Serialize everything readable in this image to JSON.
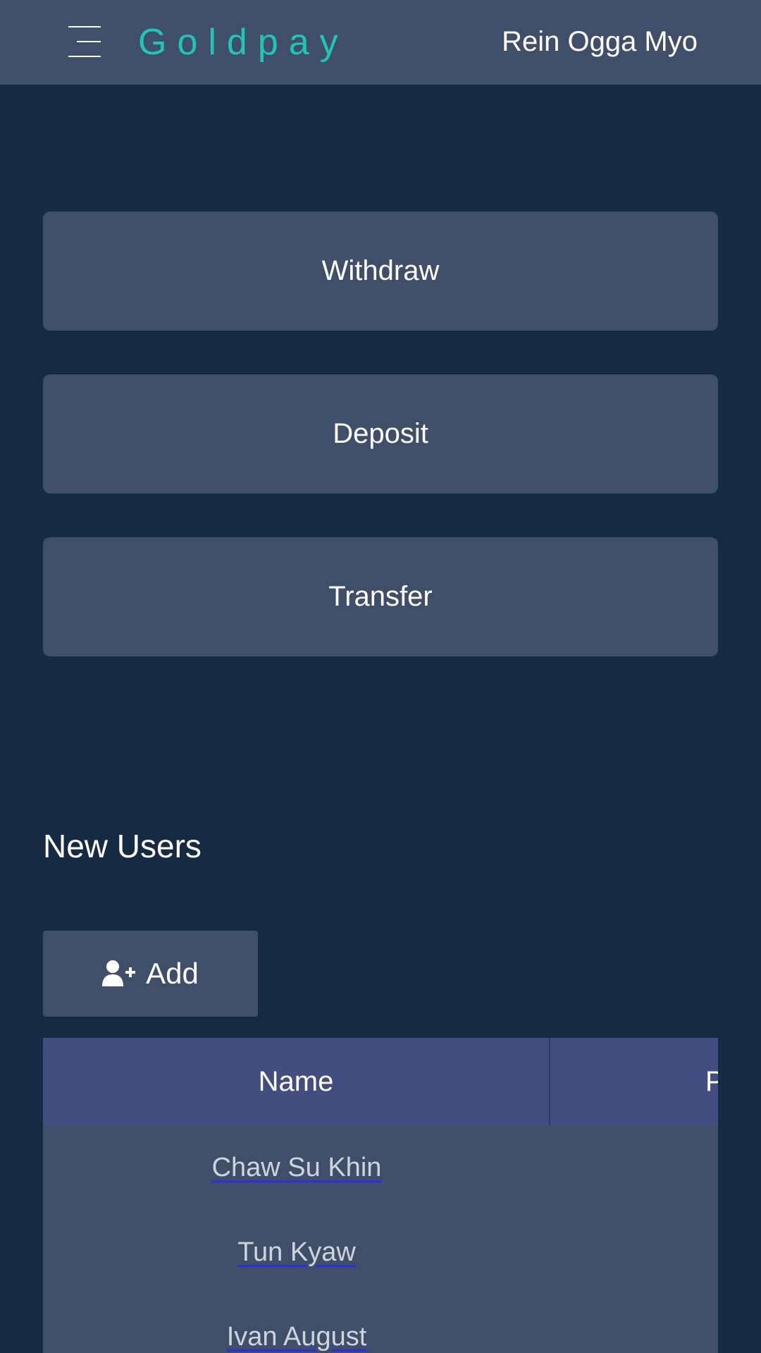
{
  "header": {
    "brand": "Goldpay",
    "user_name": "Rein Ogga Myo"
  },
  "actions": {
    "withdraw": "Withdraw",
    "deposit": "Deposit",
    "transfer": "Transfer"
  },
  "new_users": {
    "title": "New Users",
    "add_label": "Add",
    "columns": [
      "Name",
      "P"
    ],
    "rows": [
      {
        "name": "Chaw Su Khin"
      },
      {
        "name": "Tun Kyaw"
      },
      {
        "name": "Ivan August"
      }
    ]
  },
  "colors": {
    "background": "#152a43",
    "panel": "#404f69",
    "table_header": "#434e80",
    "brand": "#1fc6b6",
    "link_underline": "#2a2ee0"
  },
  "icons": {
    "menu": "hamburger-menu-icon",
    "add_user": "user-plus-icon"
  }
}
